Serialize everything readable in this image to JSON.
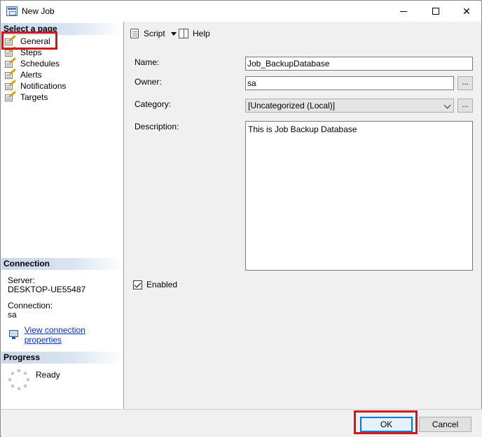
{
  "window": {
    "title": "New Job"
  },
  "left_pane": {
    "select_page_header": "Select a page",
    "pages": [
      {
        "label": "General"
      },
      {
        "label": "Steps"
      },
      {
        "label": "Schedules"
      },
      {
        "label": "Alerts"
      },
      {
        "label": "Notifications"
      },
      {
        "label": "Targets"
      }
    ],
    "connection_header": "Connection",
    "server_label": "Server:",
    "server_value": "DESKTOP-UE55487",
    "connection_label": "Connection:",
    "connection_value": "sa",
    "view_connection_link": "View connection properties",
    "progress_header": "Progress",
    "progress_status": "Ready"
  },
  "toolbar": {
    "script_label": "Script",
    "help_label": "Help"
  },
  "form": {
    "name_label": "Name:",
    "name_value": "Job_BackupDatabase",
    "owner_label": "Owner:",
    "owner_value": "sa",
    "category_label": "Category:",
    "category_value": "[Uncategorized (Local)]",
    "description_label": "Description:",
    "description_value": "This is Job Backup Database",
    "enabled_label": "Enabled",
    "enabled_checked": true,
    "browse_label": "..."
  },
  "buttons": {
    "ok_label": "OK",
    "cancel_label": "Cancel"
  },
  "colors": {
    "highlight_annotation": "#d0191c",
    "link": "#0033cc",
    "section_header": "#c9d8ea"
  }
}
